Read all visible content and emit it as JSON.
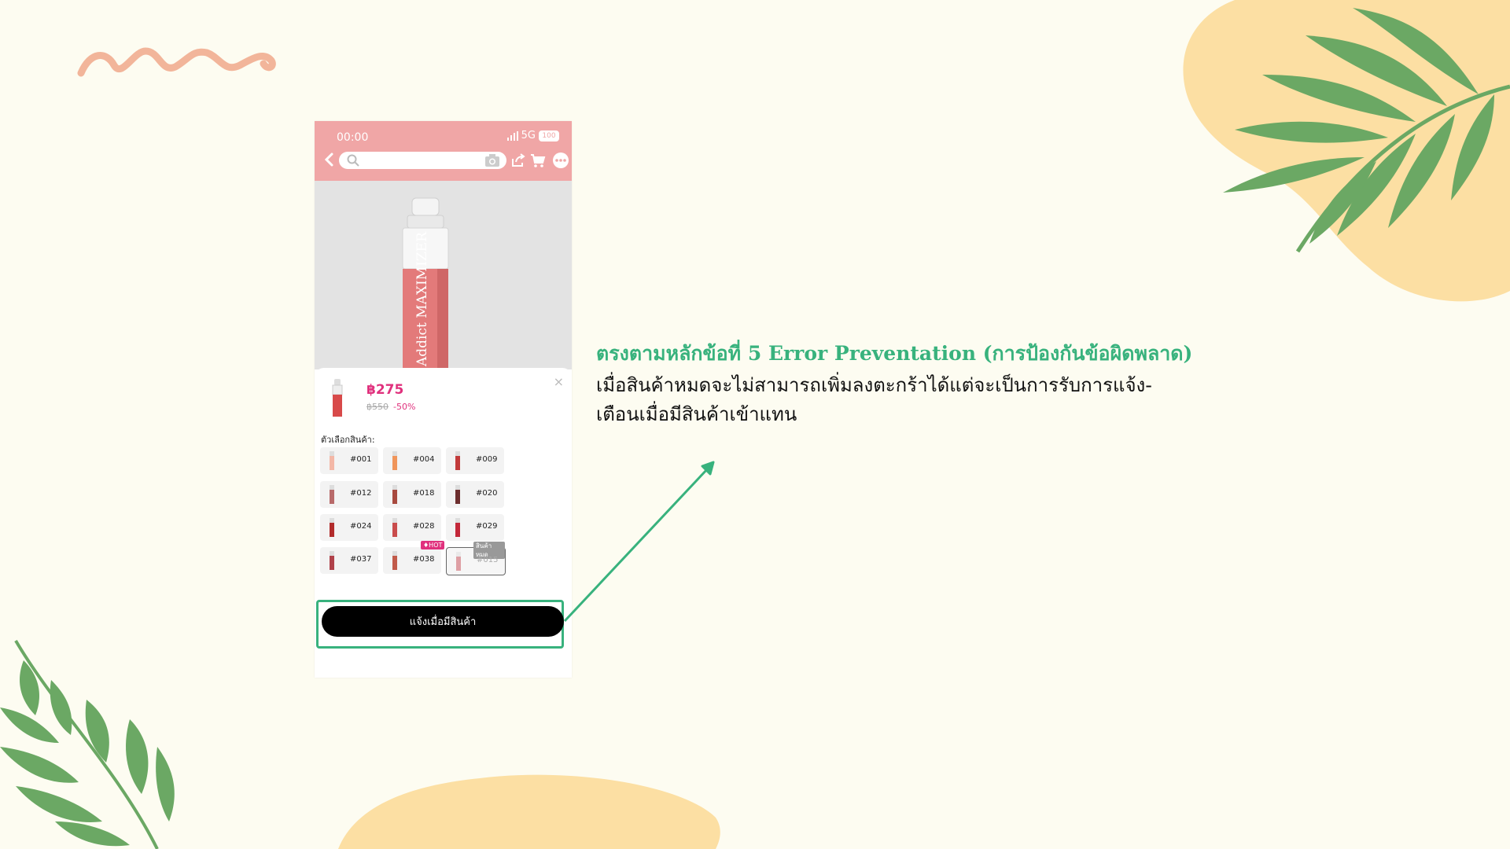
{
  "phone": {
    "status_time": "00:00",
    "network": "5G",
    "battery": "100",
    "icons": {
      "back": "chevron-left-icon",
      "search": "search-icon",
      "camera": "camera-icon",
      "share": "share-icon",
      "cart": "cart-icon",
      "more": "more-icon"
    },
    "product_text": "Addict MAXIMIZER"
  },
  "sheet": {
    "price": "฿275",
    "old_price": "฿550",
    "discount": "-50%",
    "close": "×",
    "options_label": "ตัวเลือกสินค้า:",
    "options": [
      {
        "code": "#001",
        "color": "#f3b7a6"
      },
      {
        "code": "#004",
        "color": "#f0955a"
      },
      {
        "code": "#009",
        "color": "#c23b3b"
      },
      {
        "code": "#012",
        "color": "#b86a6a"
      },
      {
        "code": "#018",
        "color": "#a84a3f"
      },
      {
        "code": "#020",
        "color": "#6d2f2f"
      },
      {
        "code": "#024",
        "color": "#b22b2b"
      },
      {
        "code": "#028",
        "color": "#c94c4c"
      },
      {
        "code": "#029",
        "color": "#c3283a"
      },
      {
        "code": "#037",
        "color": "#b0414a"
      },
      {
        "code": "#038",
        "color": "#c15a4a"
      },
      {
        "code": "#015",
        "color": "#c84a55"
      }
    ],
    "hot_badge": "♦HOT",
    "out_badge": "สินค้าหมด",
    "notify_button": "แจ้งเมื่อมีสินค้า"
  },
  "annotation": {
    "heading": "ตรงตามหลักข้อที่ 5 Error Preventation (การป้องกันข้อผิดพลาด)",
    "line1": "เมื่อสินค้าหมดจะไม่สามารถเพิ่มลงตะกร้าได้แต่จะเป็นการรับการแจ้ง-",
    "line2": "เตือนเมื่อมีสินค้าเข้าแทน"
  },
  "colors": {
    "background": "#fdfcf1",
    "accent_green": "#38b27d",
    "header_pink": "#f0a6a6",
    "price_pink": "#e0317d",
    "leaf_green": "#6ba864",
    "blob_yellow": "#fcdfa3",
    "squiggle": "#f2b59a"
  }
}
